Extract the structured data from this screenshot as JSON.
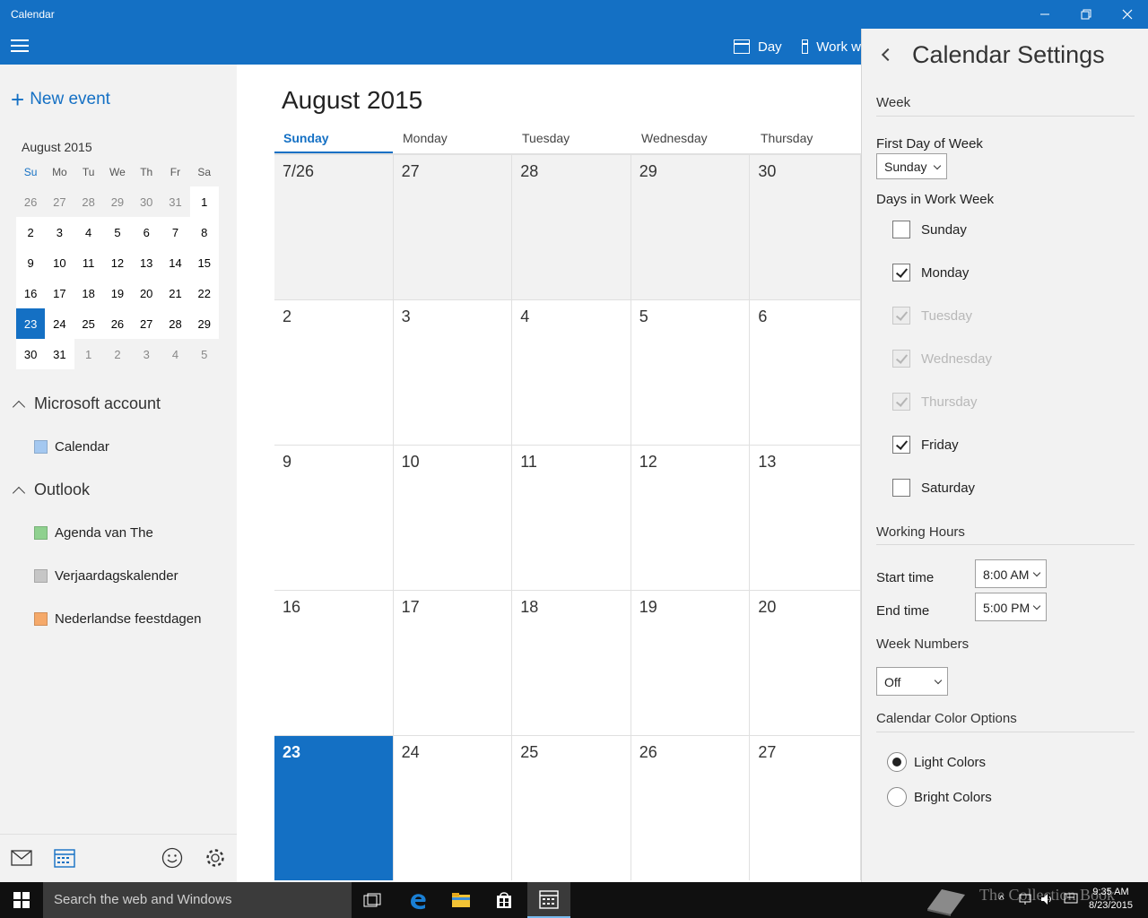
{
  "window": {
    "title": "Calendar"
  },
  "appbar": {
    "views": [
      "Day",
      "Work w"
    ]
  },
  "left": {
    "new_event": "New event",
    "mini_calendar": {
      "title": "August 2015",
      "weekdays": [
        "Su",
        "Mo",
        "Tu",
        "We",
        "Th",
        "Fr",
        "Sa"
      ],
      "weeks": [
        [
          "26",
          "27",
          "28",
          "29",
          "30",
          "31",
          "1"
        ],
        [
          "2",
          "3",
          "4",
          "5",
          "6",
          "7",
          "8"
        ],
        [
          "9",
          "10",
          "11",
          "12",
          "13",
          "14",
          "15"
        ],
        [
          "16",
          "17",
          "18",
          "19",
          "20",
          "21",
          "22"
        ],
        [
          "23",
          "24",
          "25",
          "26",
          "27",
          "28",
          "29"
        ],
        [
          "30",
          "31",
          "1",
          "2",
          "3",
          "4",
          "5"
        ]
      ]
    },
    "groups": [
      {
        "name": "Microsoft account",
        "calendars": [
          {
            "name": "Calendar",
            "color": "#a4c8f0"
          }
        ]
      },
      {
        "name": "Outlook",
        "calendars": [
          {
            "name": "Agenda van The",
            "color": "#8fd18f"
          },
          {
            "name": "Verjaardagskalender",
            "color": "#c6c6c6"
          },
          {
            "name": "Nederlandse feestdagen",
            "color": "#f5a96a"
          }
        ]
      }
    ]
  },
  "main": {
    "month_title": "August 2015",
    "weekdays": [
      "Sunday",
      "Monday",
      "Tuesday",
      "Wednesday",
      "Thursday"
    ],
    "weeks": [
      [
        "7/26",
        "27",
        "28",
        "29",
        "30"
      ],
      [
        "2",
        "3",
        "4",
        "5",
        "6"
      ],
      [
        "9",
        "10",
        "11",
        "12",
        "13"
      ],
      [
        "16",
        "17",
        "18",
        "19",
        "20"
      ],
      [
        "23",
        "24",
        "25",
        "26",
        "27"
      ]
    ]
  },
  "settings": {
    "title": "Calendar Settings",
    "week_header": "Week",
    "first_day_label": "First Day of Week",
    "first_day_value": "Sunday",
    "work_week_label": "Days in Work Week",
    "days": [
      {
        "name": "Sunday",
        "checked": false,
        "disabled": false
      },
      {
        "name": "Monday",
        "checked": true,
        "disabled": false
      },
      {
        "name": "Tuesday",
        "checked": true,
        "disabled": true
      },
      {
        "name": "Wednesday",
        "checked": true,
        "disabled": true
      },
      {
        "name": "Thursday",
        "checked": true,
        "disabled": true
      },
      {
        "name": "Friday",
        "checked": true,
        "disabled": false
      },
      {
        "name": "Saturday",
        "checked": false,
        "disabled": false
      }
    ],
    "working_hours_header": "Working Hours",
    "start_label": "Start time",
    "start_value": "8:00 AM",
    "end_label": "End time",
    "end_value": "5:00 PM",
    "week_numbers_header": "Week Numbers",
    "week_numbers_value": "Off",
    "color_header": "Calendar Color Options",
    "color_options": [
      {
        "name": "Light Colors",
        "selected": true
      },
      {
        "name": "Bright Colors",
        "selected": false
      }
    ]
  },
  "taskbar": {
    "search_placeholder": "Search the web and Windows",
    "time": "9:35 AM",
    "date": "8/23/2015",
    "watermark": "The Collection Book"
  },
  "colors": {
    "accent": "#1470c4",
    "taskbar": "#101010"
  }
}
